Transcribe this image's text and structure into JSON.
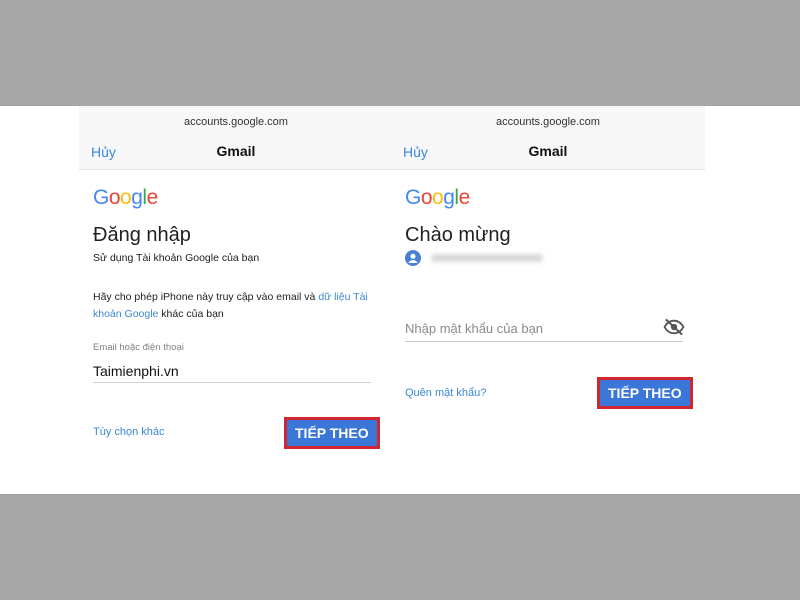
{
  "left_screen": {
    "url": "accounts.google.com",
    "cancel_label": "Hủy",
    "window_title": "Gmail",
    "logo_letters": [
      "G",
      "o",
      "o",
      "g",
      "l",
      "e"
    ],
    "heading": "Đăng nhập",
    "subtitle": "Sử dụng Tài khoản Google của bạn",
    "permission_text": "Hãy cho phép iPhone này truy cập vào email và ",
    "permission_link": "dữ liệu Tài khoản Google",
    "permission_suffix": " khác của bạn",
    "field_label": "Email hoặc điện thoại",
    "field_value": "Taimienphi.vn",
    "other_options_label": "Tùy chọn khác",
    "next_label": "TIẾP THEO"
  },
  "right_screen": {
    "url": "accounts.google.com",
    "cancel_label": "Hủy",
    "window_title": "Gmail",
    "logo_letters": [
      "G",
      "o",
      "o",
      "g",
      "l",
      "e"
    ],
    "heading": "Chào mừng",
    "password_placeholder": "Nhập mật khẩu của bạn",
    "forgot_password_label": "Quên mật khẩu?",
    "next_label": "TIẾP THEO"
  },
  "colors": {
    "link_blue": "#3a86d8",
    "button_blue": "#3b77d8",
    "highlight_red": "#d0262f",
    "google_blue": "#4285F4",
    "google_red": "#EA4335",
    "google_yellow": "#FBBC05",
    "google_green": "#34A853"
  },
  "icons": {
    "account": "account-circle-icon",
    "password_visibility": "eye-off-icon"
  }
}
